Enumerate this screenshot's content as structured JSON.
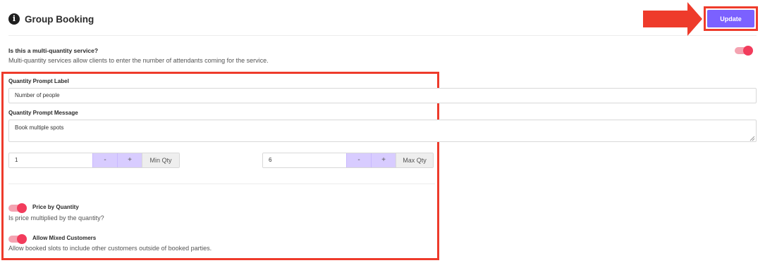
{
  "header": {
    "icon": "info-circle-icon",
    "title": "Group Booking",
    "update_label": "Update"
  },
  "multi_quantity": {
    "question": "Is this a multi-quantity service?",
    "description": "Multi-quantity services allow clients to enter the number of attendants coming for the service.",
    "enabled": true
  },
  "quantity_prompt": {
    "label": "Quantity Prompt Label",
    "value": "Number of people"
  },
  "quantity_message": {
    "label": "Quantity Prompt Message",
    "value": "Book multiple spots"
  },
  "min_qty": {
    "value": "1",
    "minus": "-",
    "plus": "+",
    "suffix": "Min Qty"
  },
  "max_qty": {
    "value": "6",
    "minus": "-",
    "plus": "+",
    "suffix": "Max Qty"
  },
  "price_by_quantity": {
    "title": "Price by Quantity",
    "description": "Is price multiplied by the quantity?",
    "enabled": true
  },
  "mixed_customers": {
    "title": "Allow Mixed Customers",
    "description": "Allow booked slots to include other customers outside of booked parties.",
    "enabled": true
  },
  "colors": {
    "accent": "#7b61ff",
    "stepper_button": "#d8ccff",
    "toggle_on": "#f23c5c",
    "annotation": "#ee3b2b"
  }
}
